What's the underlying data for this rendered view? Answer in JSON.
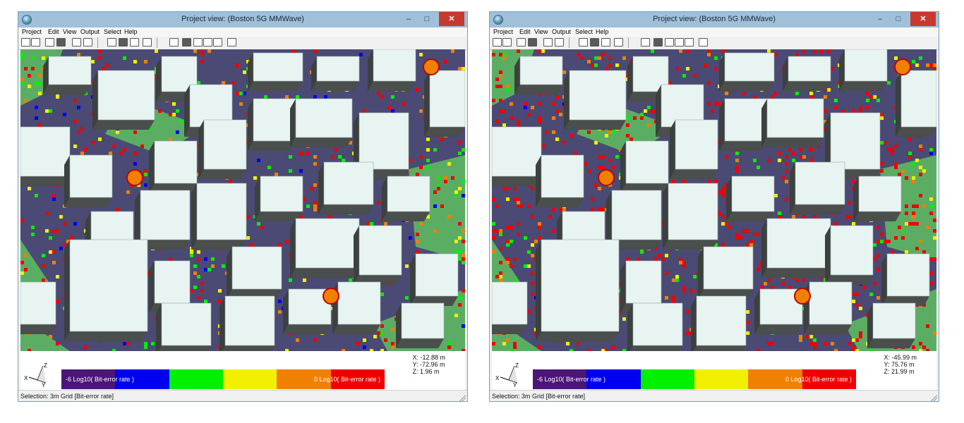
{
  "colors": {
    "ground": "#4a4a74",
    "park": "#5cad64",
    "building_top": "#e8f4f2",
    "building_side": "#4a4e4c",
    "colorbar": [
      "#4c1578",
      "#0000f0",
      "#00f000",
      "#f0f000",
      "#f08000",
      "#f00000"
    ]
  },
  "windows": [
    {
      "id": "left",
      "title": "Project view: (Boston 5G MMWave)",
      "menu": [
        "Project",
        "Edit",
        "View",
        "Output",
        "Select",
        "Help"
      ],
      "colorbar_min_label": "-6 Log10( Bit-error rate )",
      "colorbar_max_label": "0 Log10( Bit-error rate )",
      "coords": {
        "x": "X: -12.88 m",
        "y": "Y: -72.96 m",
        "z": "Z: 1.96 m"
      },
      "status": "Selection: 3m Grid [Bit-error rate]",
      "coverage_level": 0.35,
      "axis_labels": {
        "x": "X",
        "y": "Y",
        "z": "Z"
      }
    },
    {
      "id": "right",
      "title": "Project view: (Boston 5G MMWave)",
      "menu": [
        "Project",
        "Edit",
        "View",
        "Output",
        "Select",
        "Help"
      ],
      "colorbar_min_label": "-6 Log10( Bit-error rate )",
      "colorbar_max_label": "0 Log10( Bit-error rate )",
      "coords": {
        "x": "X: -45.99 m",
        "y": "Y: 75.76 m",
        "z": "Z: 21.99 m"
      },
      "status": "Selection: 3m Grid [Bit-error rate]",
      "coverage_level": 0.75,
      "axis_labels": {
        "x": "X",
        "y": "Y",
        "z": "Z"
      }
    }
  ],
  "window_buttons": {
    "minimize": "–",
    "maximize": "□",
    "close": "✕"
  }
}
